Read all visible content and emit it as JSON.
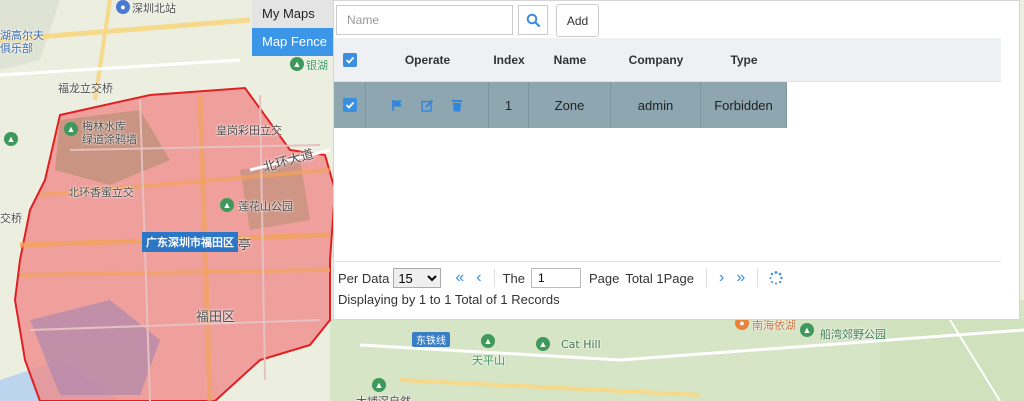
{
  "tabs": {
    "my_maps": "My Maps",
    "map_fence": "Map Fence"
  },
  "toolbar": {
    "search_placeholder": "Name",
    "add_label": "Add"
  },
  "table": {
    "headers": {
      "operate": "Operate",
      "index": "Index",
      "name": "Name",
      "company": "Company",
      "type": "Type"
    },
    "rows": [
      {
        "index": "1",
        "name": "Zone",
        "company": "admin",
        "type": "Forbidden",
        "checked": true
      }
    ]
  },
  "pager": {
    "per_data_label": "Per Data",
    "per_page_value": "15",
    "per_page_options": [
      "15"
    ],
    "the_label": "The",
    "page_value": "1",
    "page_label": "Page",
    "total_label": "Total 1Page",
    "display_info": "Displaying by 1 to 1 Total of 1 Records"
  },
  "map": {
    "labels": {
      "station_top": "深圳北站",
      "golf_1": "湖高尔夫",
      "golf_2": "俱乐部",
      "futian_interchange": "福龙立交桥",
      "meilin_1": "梅林水库",
      "meilin_2": "绿道涂鸦墙",
      "huanggang": "皇岗彩田立交",
      "beihuan_road": "北环大道",
      "beihuan_xiangmi": "北环香蜜立交",
      "lianhua": "莲花山公园",
      "qiao": "交桥",
      "ting": "亭",
      "district_tag": "广东深圳市福田区",
      "futian_district": "福田区",
      "yinhu": "银湖",
      "metro": "东铁线",
      "tianping": "天平山",
      "cat_hill": "Cat Hill",
      "nanhai": "南海依湖",
      "chuanwan": "船湾郊野公园",
      "bottom_road": "大埔滘自然"
    },
    "colors": {
      "fence_fill": "#f08a8a",
      "fence_stroke": "#e02020",
      "accent": "#3c96e8"
    }
  }
}
